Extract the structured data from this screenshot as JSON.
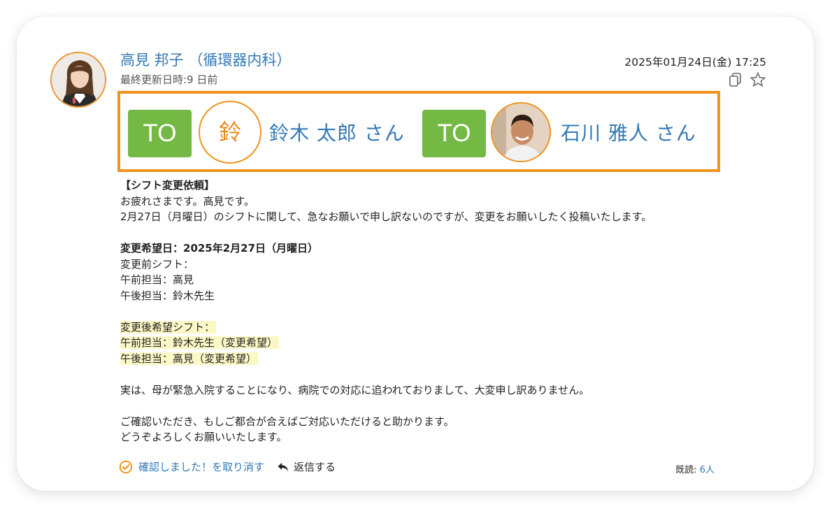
{
  "post": {
    "sender_name": "高見 邦子 （循環器内科）",
    "updated": "最終更新日時:9 日前",
    "datetime": "2025年01月24日(金) 17:25"
  },
  "icons": {
    "copy": "copy-icon",
    "star": "star-icon",
    "confirm": "check-circle-icon",
    "reply": "reply-arrow-icon"
  },
  "to": {
    "badge_label": "TO",
    "recipients": [
      {
        "initial": "鈴",
        "name": "鈴木 太郎 さん"
      },
      {
        "name": "石川 雅人 さん"
      }
    ]
  },
  "message": {
    "title": "【シフト変更依頼】",
    "greeting": "お疲れさまです。高見です。",
    "intro": "2月27日（月曜日）のシフトに関して、急なお願いで申し訳ないのですが、変更をお願いしたく投稿いたします。",
    "date_line": "変更希望日：2025年2月27日（月曜日）",
    "before_label": "変更前シフト：",
    "before_am": "午前担当：高見",
    "before_pm": "午後担当：鈴木先生",
    "after_label": "変更後希望シフト：",
    "after_am": "午前担当：鈴木先生（変更希望）",
    "after_pm": "午後担当：高見（変更希望）",
    "reason": "実は、母が緊急入院することになり、病院での対応に追われておりまして、大変申し訳ありません。",
    "closing1": "ご確認いただき、もしご都合が合えばご対応いただけると助かります。",
    "closing2": "どうぞよろしくお願いいたします。"
  },
  "footer": {
    "confirm_label": "確認しました！を取り消す",
    "reply_label": "返信する",
    "read_label": "既読:",
    "read_count": "6人"
  },
  "colors": {
    "accent_orange": "#ee941f",
    "link_blue": "#3479b5",
    "to_green": "#73b943",
    "highlight": "#fbf8c6"
  }
}
